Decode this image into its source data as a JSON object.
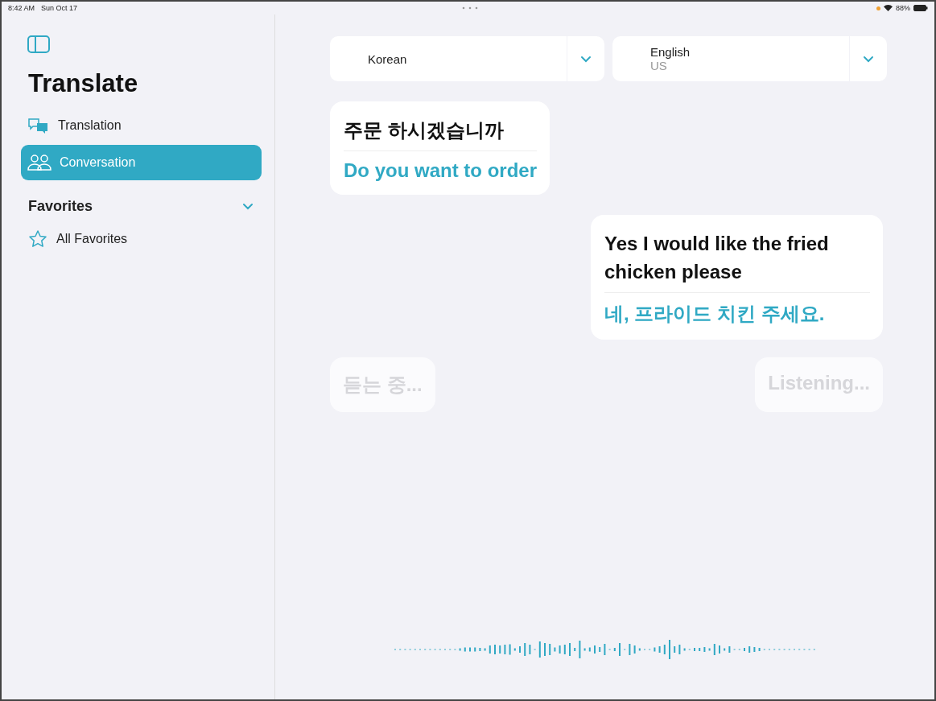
{
  "status_bar": {
    "time": "8:42 AM",
    "date": "Sun Oct 17",
    "battery": "88%"
  },
  "sidebar": {
    "title": "Translate",
    "items": [
      {
        "label": "Translation",
        "kind": "translate",
        "selected": false
      },
      {
        "label": "Conversation",
        "kind": "people",
        "selected": true
      }
    ],
    "favorites": {
      "title": "Favorites",
      "expanded": true,
      "items": [
        {
          "label": "All Favorites"
        }
      ]
    }
  },
  "languages": [
    {
      "name": "Korean"
    },
    {
      "name": "English",
      "region": "US"
    }
  ],
  "messages": [
    {
      "kind": "left",
      "source": "주문 하시겠습니까",
      "translation": "Do you want to order"
    },
    {
      "kind": "right",
      "source": "Yes I would like the fried chicken please",
      "translation": "네, 프라이드 치킨 주세요."
    }
  ],
  "listening": [
    {
      "kind": "left",
      "text": "듣는 중..."
    },
    {
      "kind": "right",
      "text": "Listening..."
    }
  ]
}
